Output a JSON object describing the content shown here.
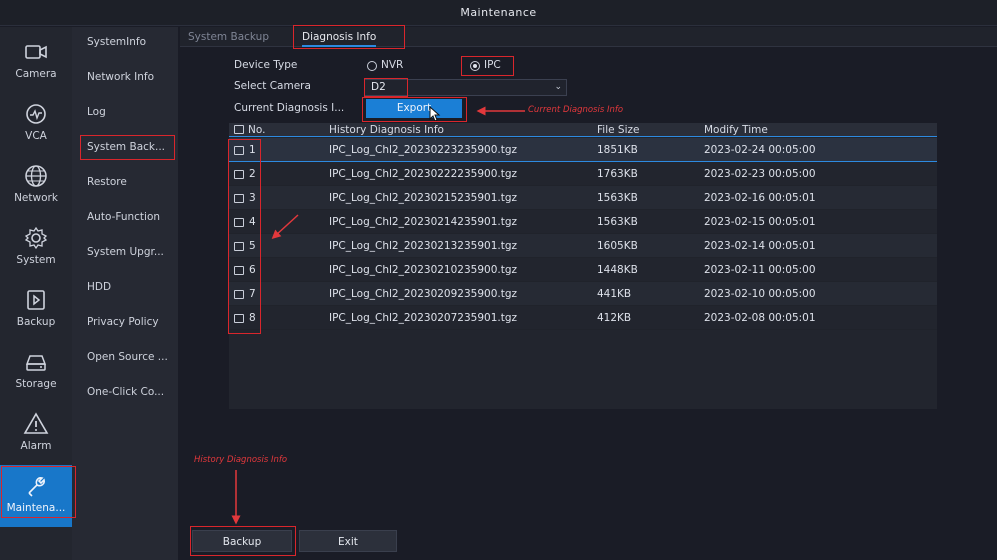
{
  "window": {
    "title": "Maintenance"
  },
  "nav": {
    "items": [
      {
        "label": "Camera",
        "icon": "camera-icon"
      },
      {
        "label": "VCA",
        "icon": "vca-icon"
      },
      {
        "label": "Network",
        "icon": "network-icon"
      },
      {
        "label": "System",
        "icon": "system-icon"
      },
      {
        "label": "Backup",
        "icon": "backup-icon"
      },
      {
        "label": "Storage",
        "icon": "storage-icon"
      },
      {
        "label": "Alarm",
        "icon": "alarm-icon"
      },
      {
        "label": "Maintena...",
        "icon": "maintenance-icon",
        "active": true
      }
    ]
  },
  "submenu": {
    "items": [
      "SystemInfo",
      "Network Info",
      "Log",
      "System Back...",
      "Restore",
      "Auto-Function",
      "System Upgr...",
      "HDD",
      "Privacy Policy",
      "Open Source ...",
      "One-Click Co..."
    ]
  },
  "tabs": [
    {
      "label": "System Backup",
      "active": false
    },
    {
      "label": "Diagnosis Info",
      "active": true
    }
  ],
  "form": {
    "device_type_label": "Device Type",
    "device_type_options": [
      "NVR",
      "IPC"
    ],
    "device_type_selected": "IPC",
    "select_camera_label": "Select Camera",
    "select_camera_value": "D2",
    "current_diag_label": "Current Diagnosis I...",
    "export_label": "Export"
  },
  "table": {
    "headers": [
      "No.",
      "History Diagnosis Info",
      "File Size",
      "Modify Time"
    ],
    "rows": [
      {
        "no": "1",
        "name": "IPC_Log_Chl2_20230223235900.tgz",
        "size": "1851KB",
        "time": "2023-02-24 00:05:00"
      },
      {
        "no": "2",
        "name": "IPC_Log_Chl2_20230222235900.tgz",
        "size": "1763KB",
        "time": "2023-02-23 00:05:00"
      },
      {
        "no": "3",
        "name": "IPC_Log_Chl2_20230215235901.tgz",
        "size": "1563KB",
        "time": "2023-02-16 00:05:01"
      },
      {
        "no": "4",
        "name": "IPC_Log_Chl2_20230214235901.tgz",
        "size": "1563KB",
        "time": "2023-02-15 00:05:01"
      },
      {
        "no": "5",
        "name": "IPC_Log_Chl2_20230213235901.tgz",
        "size": "1605KB",
        "time": "2023-02-14 00:05:01"
      },
      {
        "no": "6",
        "name": "IPC_Log_Chl2_20230210235900.tgz",
        "size": "1448KB",
        "time": "2023-02-11 00:05:00"
      },
      {
        "no": "7",
        "name": "IPC_Log_Chl2_20230209235900.tgz",
        "size": "441KB",
        "time": "2023-02-10 00:05:00"
      },
      {
        "no": "8",
        "name": "IPC_Log_Chl2_20230207235901.tgz",
        "size": "412KB",
        "time": "2023-02-08 00:05:01"
      }
    ]
  },
  "buttons": {
    "backup": "Backup",
    "exit": "Exit"
  },
  "annotations": {
    "current": "Current Diagnosis Info",
    "history": "History Diagnosis Info"
  },
  "colors": {
    "accent": "#1b7fd6",
    "annotation": "#d9262c",
    "background": "#1a1c26"
  }
}
